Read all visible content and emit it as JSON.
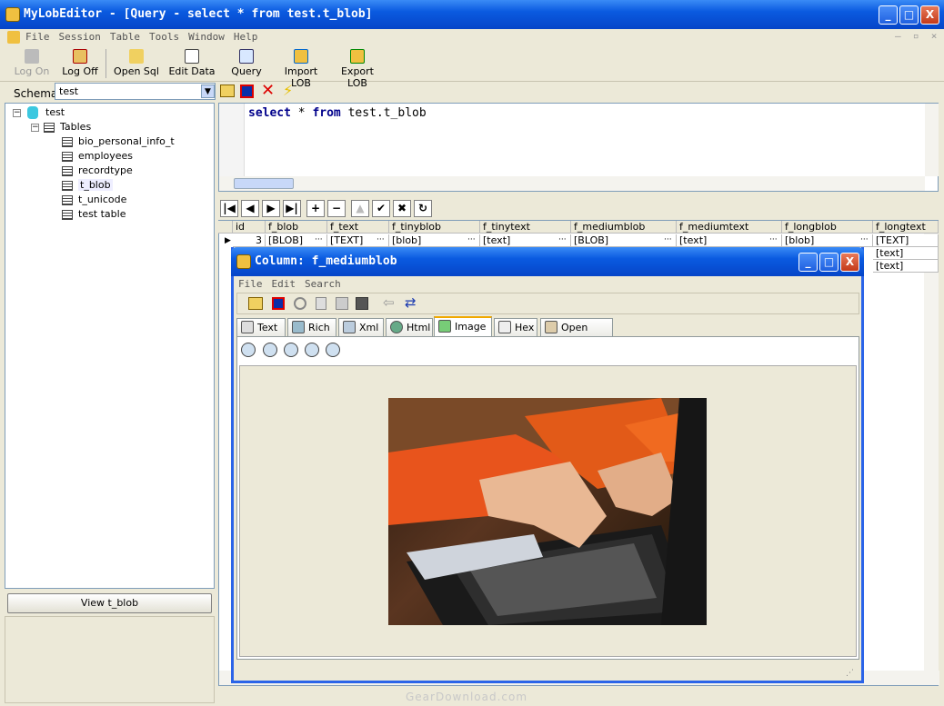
{
  "window": {
    "title": "MyLobEditor - [Query - select * from test.t_blob]",
    "controls": [
      "_",
      "□",
      "X"
    ]
  },
  "menu": [
    "File",
    "Session",
    "Table",
    "Tools",
    "Window",
    "Help"
  ],
  "toolbar": [
    {
      "label": "Log On",
      "icon": "key-icon",
      "enabled": false
    },
    {
      "label": "Log Off",
      "icon": "logoff-icon",
      "enabled": true
    },
    {
      "label": "Open Sql",
      "icon": "folder-icon",
      "enabled": true
    },
    {
      "label": "Edit Data",
      "icon": "edit-icon",
      "enabled": true
    },
    {
      "label": "Query",
      "icon": "query-icon",
      "enabled": true
    },
    {
      "label": "Import LOB",
      "icon": "import-icon",
      "enabled": true
    },
    {
      "label": "Export LOB",
      "icon": "export-icon",
      "enabled": true
    }
  ],
  "schema": {
    "label": "Schema",
    "value": "test"
  },
  "tree": {
    "root": "test",
    "folder": "Tables",
    "tables": [
      "bio_personal_info_t",
      "employees",
      "recordtype",
      "t_blob",
      "t_unicode",
      "test table"
    ],
    "selected": "t_blob"
  },
  "view_button": "View t_blob",
  "sql": {
    "kw1": "select",
    "star": " * ",
    "kw2": "from",
    "rest": " test.t_blob"
  },
  "nav_buttons": [
    "|◀",
    "◀",
    "▶",
    "▶|",
    "+",
    "−",
    "▲",
    "✔",
    "✖",
    "↻"
  ],
  "grid": {
    "columns": [
      "id",
      "f_blob",
      "f_text",
      "f_tinyblob",
      "f_tinytext",
      "f_mediumblob",
      "f_mediumtext",
      "f_longblob",
      "f_longtext"
    ],
    "rows": [
      [
        "3",
        "[BLOB]",
        "[TEXT]",
        "[blob]",
        "[text]",
        "[BLOB]",
        "[text]",
        "[blob]",
        "[TEXT]"
      ],
      [
        "",
        "",
        "",
        "",
        "",
        "",
        "",
        "",
        "[text]"
      ],
      [
        "",
        "",
        "",
        "",
        "",
        "",
        "",
        "",
        "[text]"
      ]
    ]
  },
  "popup": {
    "title": "Column: f_mediumblob",
    "menu": [
      "File",
      "Edit",
      "Search"
    ],
    "tabs": [
      "Text",
      "Rich",
      "Xml",
      "Html",
      "Image",
      "Hex",
      "Open with"
    ],
    "active_tab": "Image"
  },
  "watermark": "GearDownload.com",
  "colors": {
    "titlebar": "#0a5ae0",
    "accent": "#f0a800",
    "keyword": "#00008b",
    "delete": "#d00000"
  }
}
